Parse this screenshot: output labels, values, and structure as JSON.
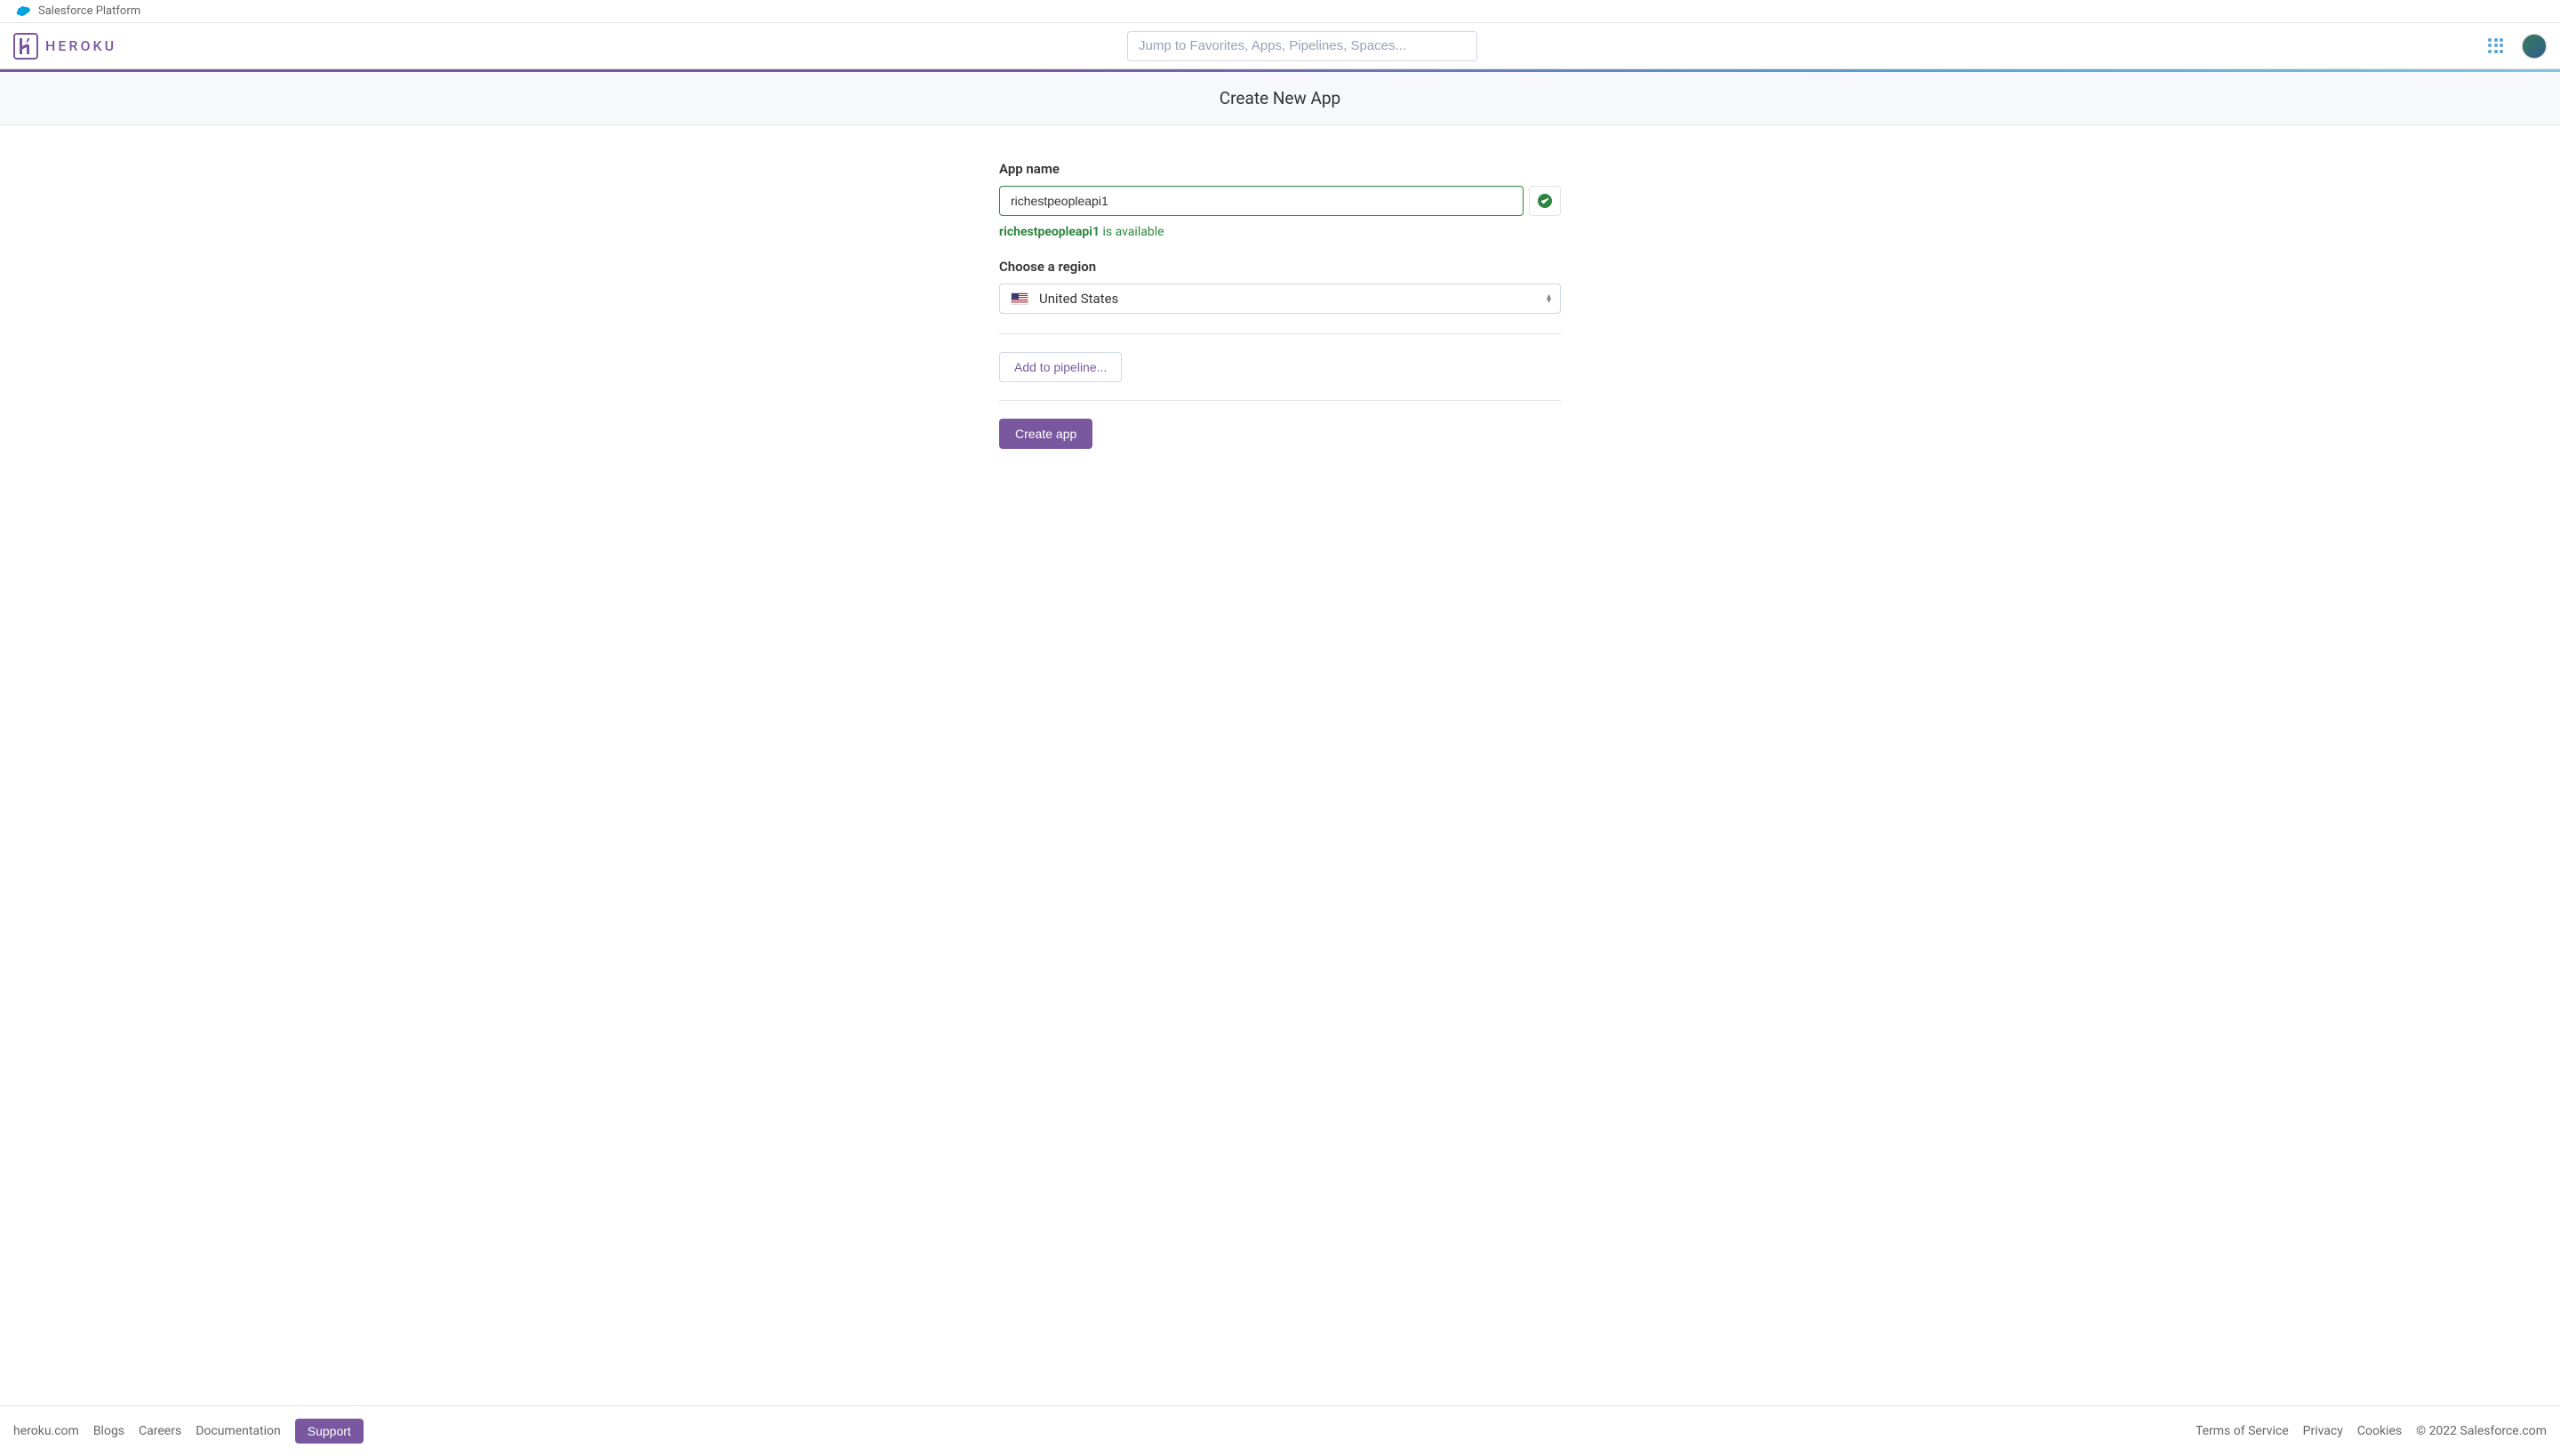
{
  "topBar": {
    "platformLabel": "Salesforce Platform"
  },
  "nav": {
    "logoText": "HEROKU",
    "searchPlaceholder": "Jump to Favorites, Apps, Pipelines, Spaces..."
  },
  "page": {
    "title": "Create New App"
  },
  "form": {
    "appNameLabel": "App name",
    "appNameValue": "richestpeopleapi1",
    "availabilityName": "richestpeopleapi1",
    "availabilitySuffix": " is available",
    "regionLabel": "Choose a region",
    "regionSelected": "United States",
    "pipelineButton": "Add to pipeline...",
    "createButton": "Create app"
  },
  "footer": {
    "leftLinks": [
      "heroku.com",
      "Blogs",
      "Careers",
      "Documentation"
    ],
    "supportButton": "Support",
    "rightLinks": [
      "Terms of Service",
      "Privacy",
      "Cookies"
    ],
    "copyright": "© 2022 Salesforce.com"
  }
}
